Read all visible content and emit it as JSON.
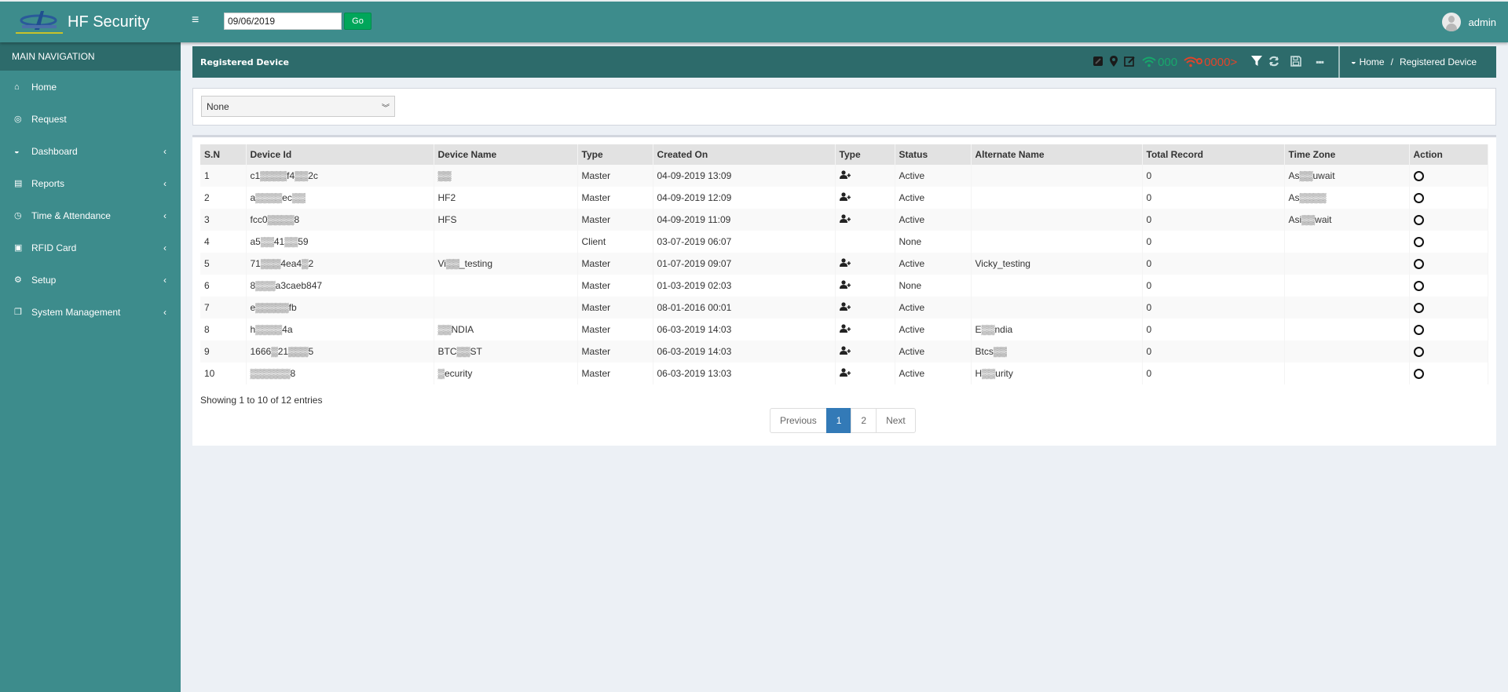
{
  "app": {
    "title": "HF Security",
    "logo_icon": "hf-security-logo"
  },
  "topbar": {
    "menu_icon": "hamburger-icon",
    "date_value": "09/06/2019",
    "go_label": "Go",
    "user_name": "admin"
  },
  "sidebar": {
    "header": "MAIN NAVIGATION",
    "items": [
      {
        "label": "Home",
        "icon": "home-icon",
        "glyph": "⌂",
        "has_children": false
      },
      {
        "label": "Request",
        "icon": "target-icon",
        "glyph": "◎",
        "has_children": false
      },
      {
        "label": "Dashboard",
        "icon": "dashboard-icon",
        "glyph": "◒",
        "has_children": true
      },
      {
        "label": "Reports",
        "icon": "file-text-icon",
        "glyph": "▤",
        "has_children": true
      },
      {
        "label": "Time & Attendance",
        "icon": "clock-icon",
        "glyph": "◷",
        "has_children": true
      },
      {
        "label": "RFID Card",
        "icon": "id-card-icon",
        "glyph": "▣",
        "has_children": true
      },
      {
        "label": "Setup",
        "icon": "gears-icon",
        "glyph": "⚙",
        "has_children": true
      },
      {
        "label": "System Management",
        "icon": "clone-icon",
        "glyph": "❐",
        "has_children": true
      }
    ],
    "chevron": "‹"
  },
  "page": {
    "title": "Registered Device",
    "tools": {
      "online_count": "000",
      "offline_count": "0000>",
      "more": "▪▪▪"
    },
    "breadcrumb": {
      "home": "Home",
      "separator": "/",
      "current": "Registered Device"
    }
  },
  "filter": {
    "selected": "None",
    "caret": "⌄"
  },
  "table": {
    "columns": [
      "S.N",
      "Device Id",
      "Device Name",
      "Type",
      "Created On",
      "Type",
      "Status",
      "Alternate Name",
      "Total Record",
      "Time Zone",
      "Action"
    ],
    "rows": [
      {
        "sn": "1",
        "device_id": "c1▒▒▒▒f4▒▒2c",
        "device_name": "▒▒",
        "type": "Master",
        "created_on": "04-09-2019 13:09",
        "has_user_icon": true,
        "status": "Active",
        "alternate_name": "",
        "total_record": "0",
        "time_zone": "As▒▒uwait"
      },
      {
        "sn": "2",
        "device_id": "a▒▒▒▒ec▒▒",
        "device_name": "HF2",
        "type": "Master",
        "created_on": "04-09-2019 12:09",
        "has_user_icon": true,
        "status": "Active",
        "alternate_name": "",
        "total_record": "0",
        "time_zone": "As▒▒▒▒"
      },
      {
        "sn": "3",
        "device_id": "fcc0▒▒▒▒8",
        "device_name": "HFS",
        "type": "Master",
        "created_on": "04-09-2019 11:09",
        "has_user_icon": true,
        "status": "Active",
        "alternate_name": "",
        "total_record": "0",
        "time_zone": "Asi▒▒wait"
      },
      {
        "sn": "4",
        "device_id": "a5▒▒41▒▒59",
        "device_name": "",
        "type": "Client",
        "created_on": "03-07-2019 06:07",
        "has_user_icon": false,
        "status": "None",
        "alternate_name": "",
        "total_record": "0",
        "time_zone": ""
      },
      {
        "sn": "5",
        "device_id": "71▒▒▒4ea4▒2",
        "device_name": "Vi▒▒_testing",
        "type": "Master",
        "created_on": "01-07-2019 09:07",
        "has_user_icon": true,
        "status": "Active",
        "alternate_name": "Vicky_testing",
        "total_record": "0",
        "time_zone": ""
      },
      {
        "sn": "6",
        "device_id": "8▒▒▒a3caeb847",
        "device_name": "",
        "type": "Master",
        "created_on": "01-03-2019 02:03",
        "has_user_icon": true,
        "status": "None",
        "alternate_name": "",
        "total_record": "0",
        "time_zone": ""
      },
      {
        "sn": "7",
        "device_id": "e▒▒▒▒▒fb",
        "device_name": "",
        "type": "Master",
        "created_on": "08-01-2016 00:01",
        "has_user_icon": true,
        "status": "Active",
        "alternate_name": "",
        "total_record": "0",
        "time_zone": ""
      },
      {
        "sn": "8",
        "device_id": "h▒▒▒▒4a",
        "device_name": "▒▒NDIA",
        "type": "Master",
        "created_on": "06-03-2019 14:03",
        "has_user_icon": true,
        "status": "Active",
        "alternate_name": "E▒▒ndia",
        "total_record": "0",
        "time_zone": ""
      },
      {
        "sn": "9",
        "device_id": "1666▒21▒▒▒5",
        "device_name": "BTC▒▒ST",
        "type": "Master",
        "created_on": "06-03-2019 14:03",
        "has_user_icon": true,
        "status": "Active",
        "alternate_name": "Btcs▒▒",
        "total_record": "0",
        "time_zone": ""
      },
      {
        "sn": "10",
        "device_id": "▒▒▒▒▒▒8",
        "device_name": "▒ecurity",
        "type": "Master",
        "created_on": "06-03-2019 13:03",
        "has_user_icon": true,
        "status": "Active",
        "alternate_name": "H▒▒urity",
        "total_record": "0",
        "time_zone": ""
      }
    ]
  },
  "pagination": {
    "info": "Showing 1 to 10 of 12 entries",
    "previous": "Previous",
    "pages": [
      "1",
      "2"
    ],
    "active_page": "1",
    "next": "Next"
  },
  "colors": {
    "header_bg": "#3d8c8c",
    "page_header_bg": "#2d6b6b",
    "go_button": "#00a65a",
    "online": "#17a86b",
    "offline": "#e2442a",
    "active_page": "#337ab7"
  }
}
